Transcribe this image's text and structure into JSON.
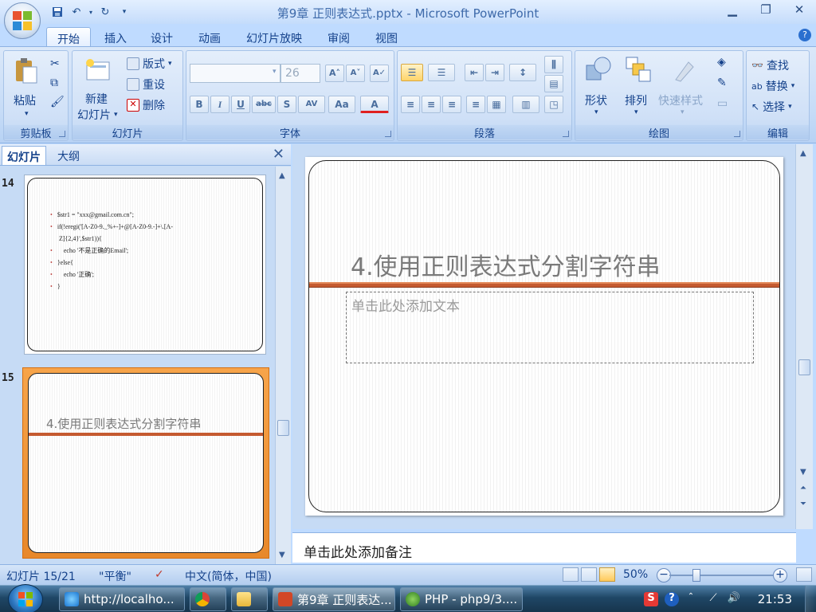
{
  "window": {
    "title": "第9章 正则表达式.pptx - Microsoft PowerPoint",
    "controls": [
      "minimize",
      "restore",
      "close"
    ]
  },
  "ribbon_tabs": [
    "开始",
    "插入",
    "设计",
    "动画",
    "幻灯片放映",
    "审阅",
    "视图"
  ],
  "active_tab": "开始",
  "groups": {
    "clipboard": {
      "label": "剪贴板",
      "paste": "粘贴"
    },
    "slides": {
      "label": "幻灯片",
      "new_slide": "新建",
      "new_slide_2": "幻灯片",
      "layout": "版式",
      "reset": "重设",
      "delete": "删除"
    },
    "font": {
      "label": "字体",
      "font_name": "",
      "font_size": "26",
      "bold": "B",
      "italic": "I",
      "underline": "U",
      "strike": "abc",
      "shadow": "S",
      "spacing": "AV",
      "case": "Aa",
      "color": "A"
    },
    "paragraph": {
      "label": "段落"
    },
    "drawing": {
      "label": "绘图",
      "shape": "形状",
      "arrange": "排列",
      "quick_styles": "快速样式"
    },
    "editing": {
      "label": "编辑",
      "find": "查找",
      "replace": "替换",
      "select": "选择"
    }
  },
  "panel": {
    "tabs": [
      "幻灯片",
      "大纲"
    ],
    "active_tab": "幻灯片"
  },
  "thumbnails": [
    {
      "number": "14",
      "lines": [
        "$str1 = \"xxx@gmail.com.cn\";",
        "if(!eregi('[A-Z0-9._%+-]+@[A-Z0-9.-]+\\.[A-",
        "Z]{2,4}',$str1)){",
        "    echo '不是正确的Email';",
        "}else{",
        "    echo '正确';",
        "}"
      ],
      "selected": false
    },
    {
      "number": "15",
      "title": "4.使用正则表达式分割字符串",
      "selected": true
    }
  ],
  "slide": {
    "title": "4.使用正则表达式分割字符串",
    "body_placeholder": "单击此处添加文本",
    "accent_color": "#c55a30"
  },
  "notes": {
    "placeholder": "单击此处添加备注"
  },
  "status": {
    "slide_pos": "幻灯片 15/21",
    "theme": "\"平衡\"",
    "language": "中文(简体，中国)",
    "zoom": "50%",
    "zoom_level": 0.5
  },
  "taskbar": {
    "items": [
      {
        "label": "http://localho...",
        "icon": "ie-icon"
      },
      {
        "label": "",
        "icon": "chrome-icon"
      },
      {
        "label": "",
        "icon": "folder-icon"
      },
      {
        "label": "第9章 正则表达...",
        "icon": "powerpoint-icon",
        "active": true
      },
      {
        "label": "PHP - php9/3....",
        "icon": "php-icon"
      }
    ],
    "clock": "21:53"
  },
  "colors": {
    "ribbon_bg": "#c5dbf7",
    "selected_thumb": "#e8882a",
    "taskbar": "#1f4766"
  }
}
